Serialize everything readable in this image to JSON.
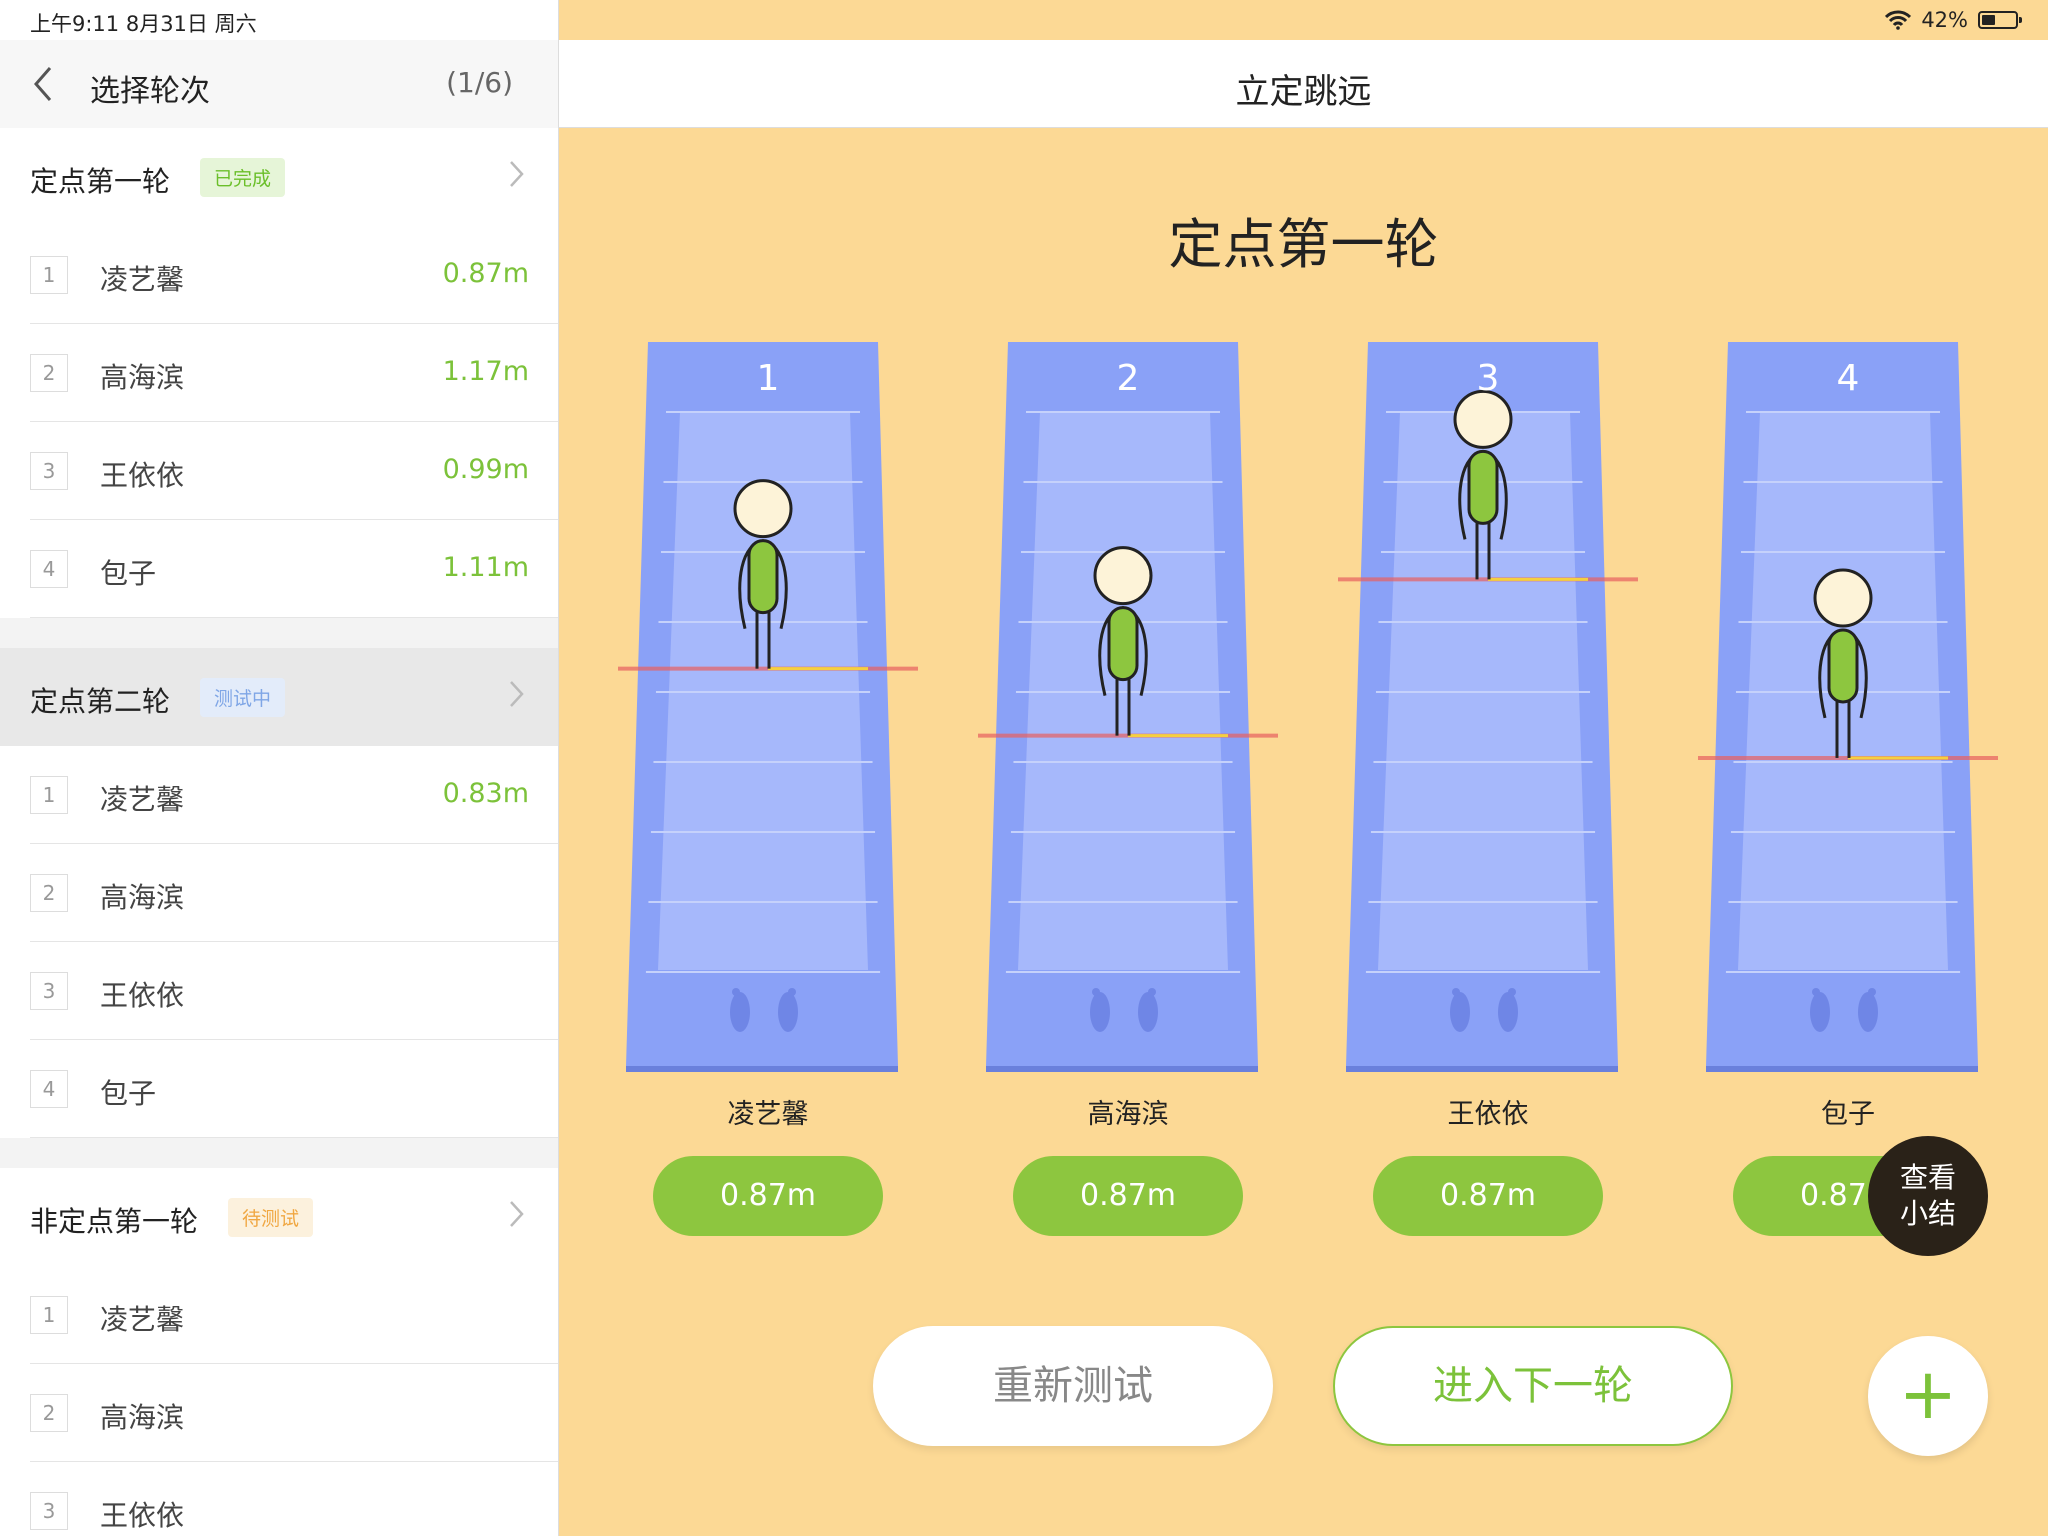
{
  "status_bar": {
    "time": "上午9:11  8月31日 周六",
    "battery": "42%",
    "battery_level": 0.42
  },
  "sidebar": {
    "back_icon": "chevron-left-icon",
    "title": "选择轮次",
    "count": "(1/6)",
    "rounds": [
      {
        "name": "定点第一轮",
        "badge": "已完成",
        "badge_type": "done",
        "players": [
          {
            "num": "1",
            "name": "凌艺馨",
            "score": "0.87m"
          },
          {
            "num": "2",
            "name": "高海滨",
            "score": "1.17m"
          },
          {
            "num": "3",
            "name": "王依依",
            "score": "0.99m"
          },
          {
            "num": "4",
            "name": "包子",
            "score": "1.11m"
          }
        ]
      },
      {
        "name": "定点第二轮",
        "badge": "测试中",
        "badge_type": "testing",
        "players": [
          {
            "num": "1",
            "name": "凌艺馨",
            "score": "0.83m"
          },
          {
            "num": "2",
            "name": "高海滨",
            "score": ""
          },
          {
            "num": "3",
            "name": "王依依",
            "score": ""
          },
          {
            "num": "4",
            "name": "包子",
            "score": ""
          }
        ]
      },
      {
        "name": "非定点第一轮",
        "badge": "待测试",
        "badge_type": "waiting",
        "players": [
          {
            "num": "1",
            "name": "凌艺馨",
            "score": ""
          },
          {
            "num": "2",
            "name": "高海滨",
            "score": ""
          },
          {
            "num": "3",
            "name": "王依依",
            "score": ""
          }
        ]
      }
    ]
  },
  "header": {
    "title": "立定跳远"
  },
  "main": {
    "round_title": "定点第一轮",
    "lanes": [
      {
        "num": "1",
        "name": "凌艺馨",
        "result": "0.87m",
        "jump_level": 0.54
      },
      {
        "num": "2",
        "name": "高海滨",
        "result": "0.87m",
        "jump_level": 0.42
      },
      {
        "num": "3",
        "name": "王依依",
        "result": "0.87m",
        "jump_level": 0.7
      },
      {
        "num": "4",
        "name": "包子",
        "result": "0.87m",
        "jump_level": 0.38
      }
    ],
    "summary_line1": "查看",
    "summary_line2": "小结",
    "retest_label": "重新测试",
    "next_label": "进入下一轮",
    "add_icon": "plus-icon"
  },
  "colors": {
    "mat": "#8aa1f7",
    "mat_inner": "#a6b8fb",
    "score_pill": "#8dc63f",
    "background": "#fcd995"
  }
}
